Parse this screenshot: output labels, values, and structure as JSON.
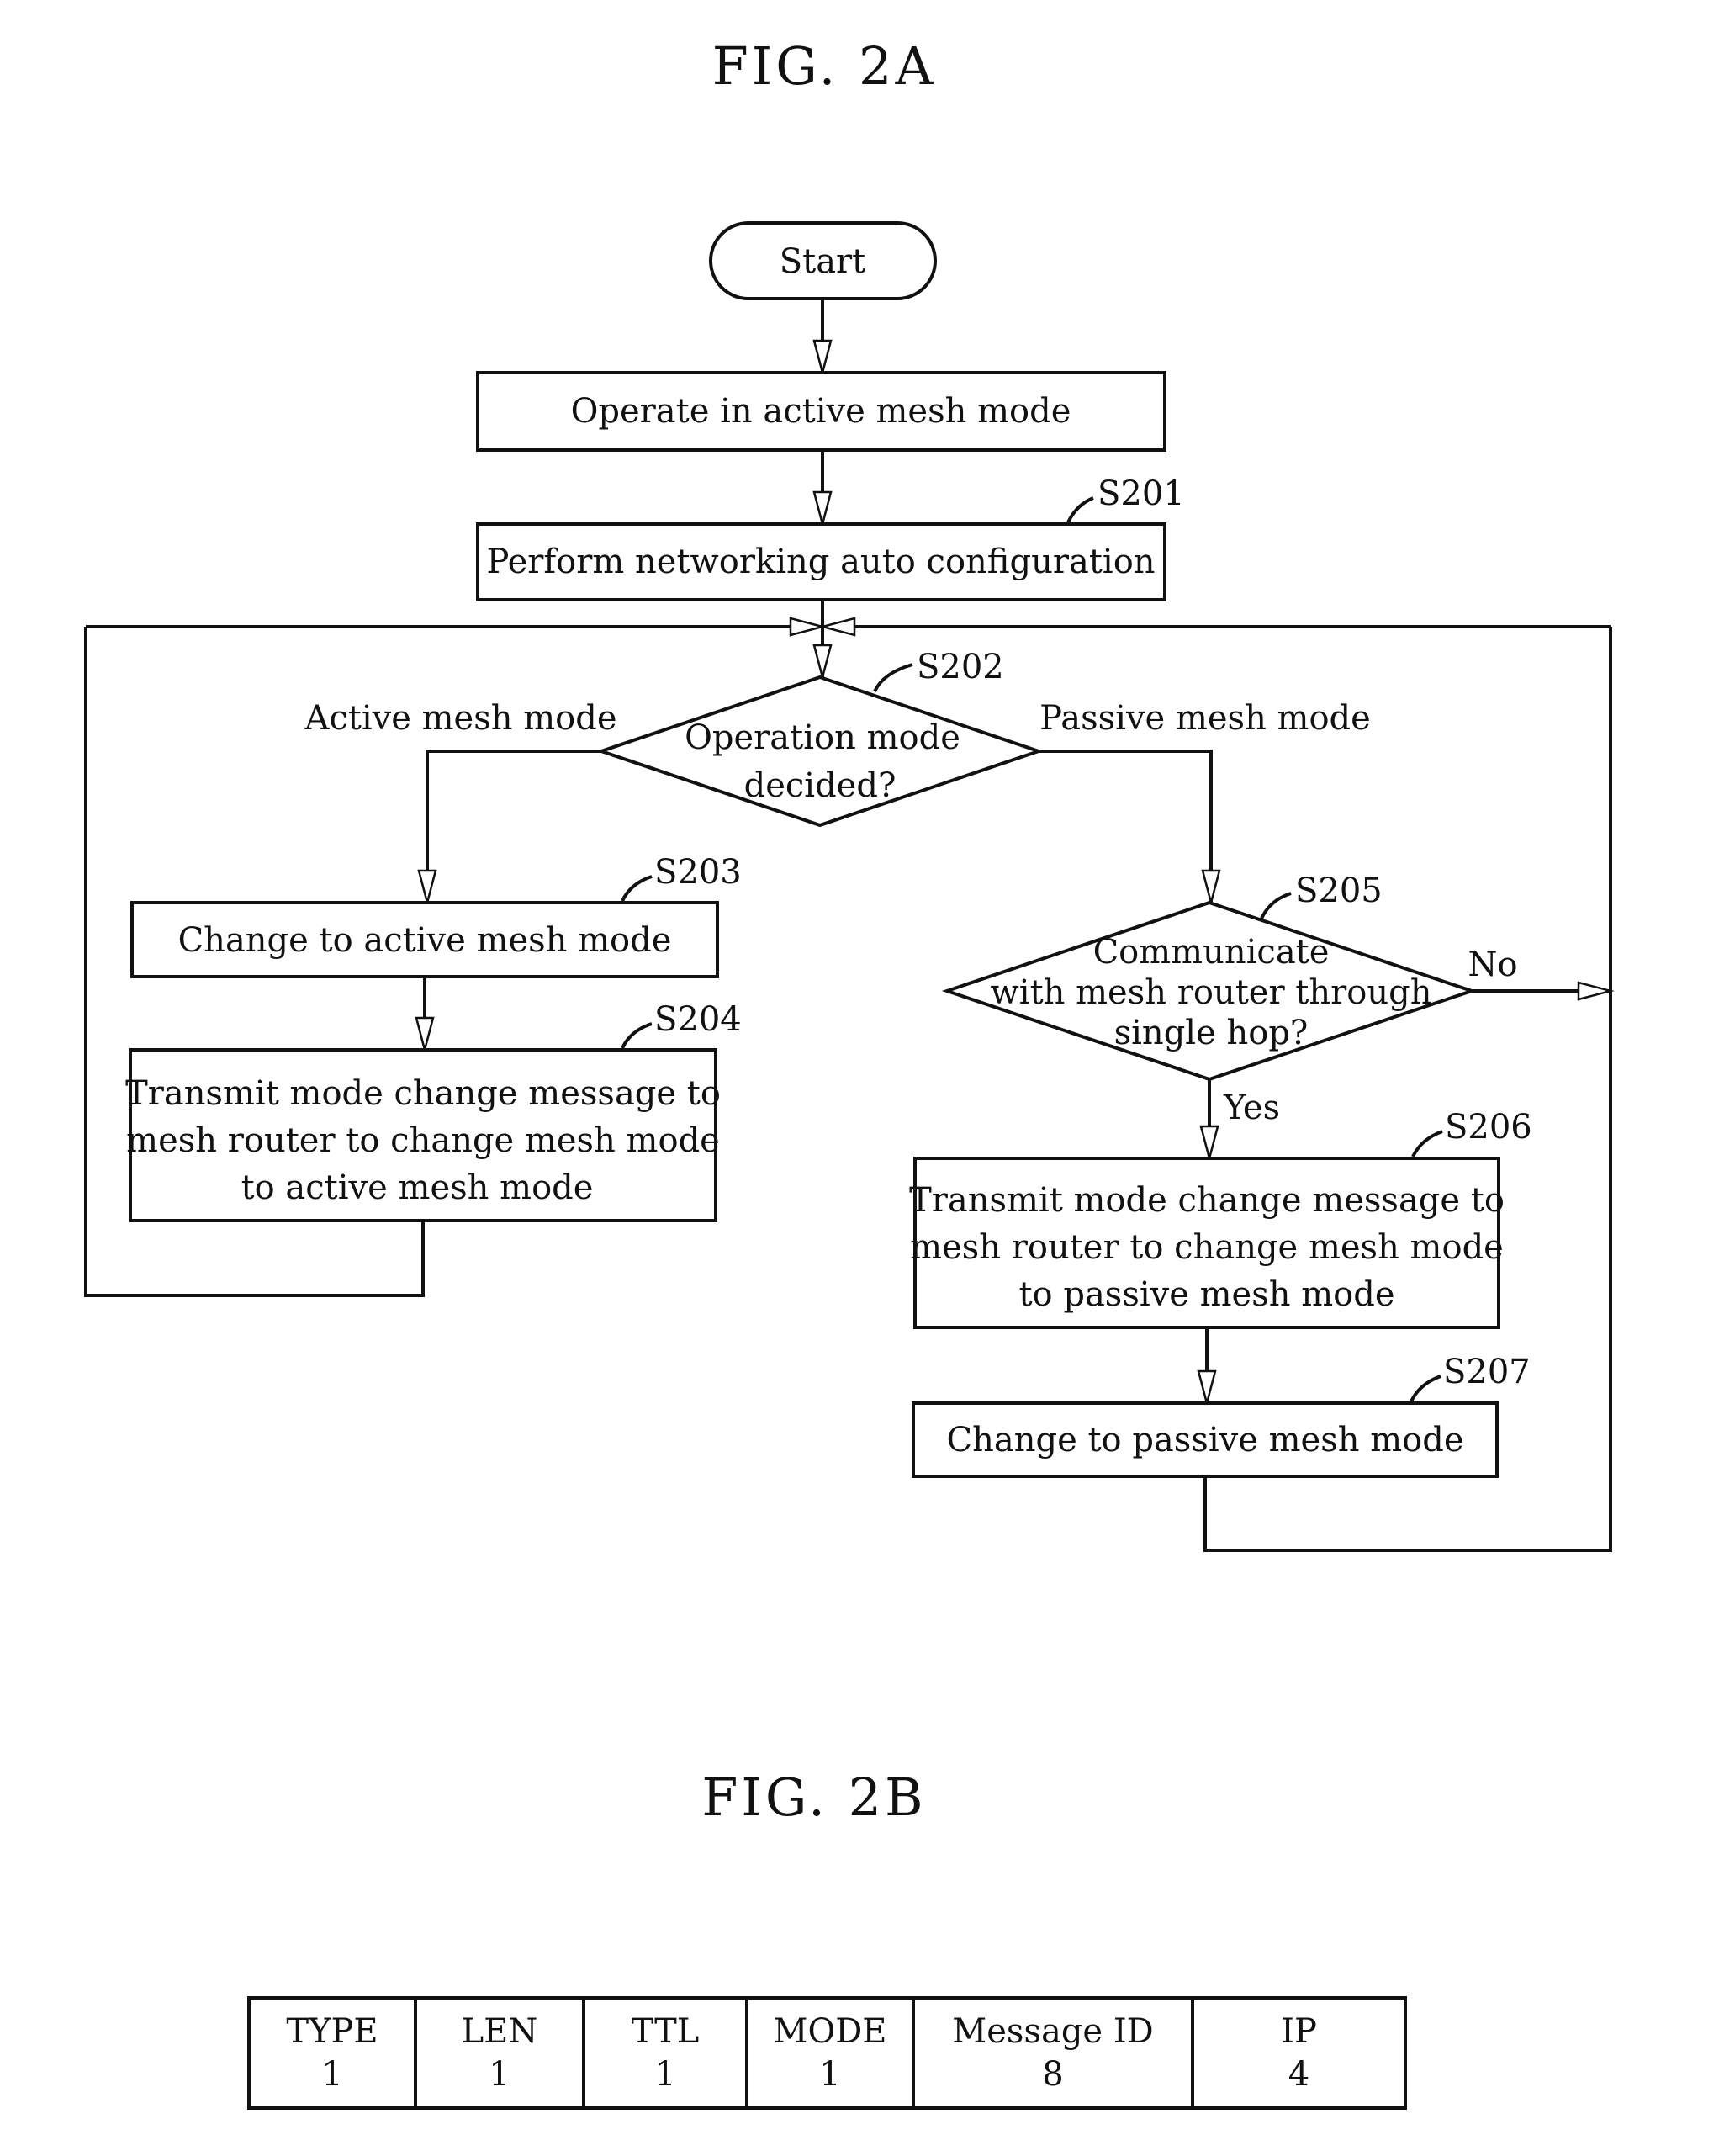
{
  "figures": {
    "fig2a": {
      "title": "FIG. 2A",
      "start": {
        "label": "Start"
      },
      "steps": {
        "operate": {
          "lines": [
            "Operate in active mesh mode"
          ]
        },
        "s201": {
          "id": "S201",
          "lines": [
            "Perform networking auto configuration"
          ]
        },
        "s202": {
          "id": "S202",
          "lines": [
            "Operation mode",
            "decided?"
          ]
        },
        "s203": {
          "id": "S203",
          "lines": [
            "Change to active mesh mode"
          ]
        },
        "s204": {
          "id": "S204",
          "lines": [
            "Transmit mode change message to",
            "mesh router to change mesh mode",
            "to active mesh mode"
          ]
        },
        "s205": {
          "id": "S205",
          "lines": [
            "Communicate",
            "with mesh router through",
            "single hop?"
          ]
        },
        "s206": {
          "id": "S206",
          "lines": [
            "Transmit mode change message to",
            "mesh router to change mesh mode",
            "to passive mesh mode"
          ]
        },
        "s207": {
          "id": "S207",
          "lines": [
            "Change to passive mesh mode"
          ]
        }
      },
      "branches": {
        "active": "Active mesh mode",
        "passive": "Passive mesh mode",
        "yes": "Yes",
        "no": "No"
      }
    },
    "fig2b": {
      "title": "FIG. 2B",
      "fields": [
        {
          "name": "TYPE",
          "size": "1"
        },
        {
          "name": "LEN",
          "size": "1"
        },
        {
          "name": "TTL",
          "size": "1"
        },
        {
          "name": "MODE",
          "size": "1"
        },
        {
          "name": "Message ID",
          "size": "8"
        },
        {
          "name": "IP",
          "size": "4"
        }
      ]
    }
  }
}
